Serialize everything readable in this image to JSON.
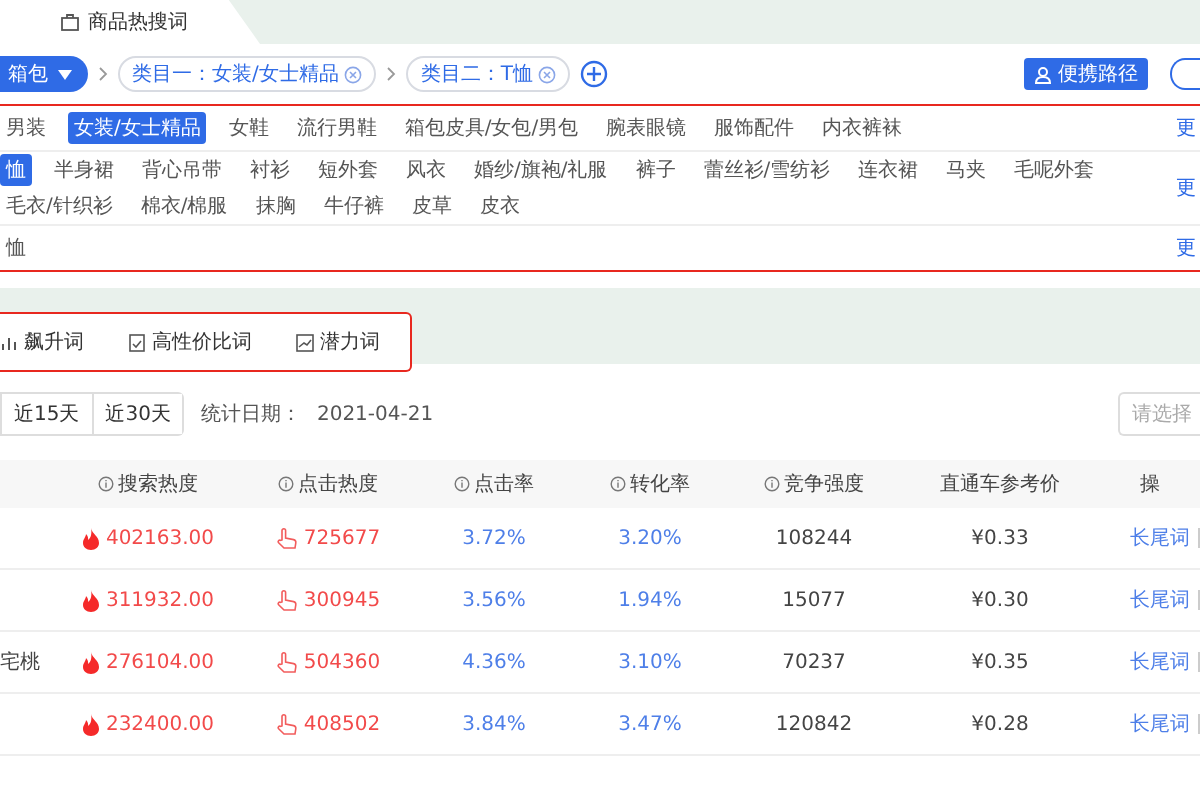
{
  "page_tab": {
    "label": "商品热搜词"
  },
  "filter_bar": {
    "category_button": "箱包",
    "chips": [
      {
        "label": "类目一：女装/女士精品"
      },
      {
        "label": "类目二：T恤"
      }
    ],
    "path_button": "便携路径"
  },
  "category_rows": [
    {
      "items": [
        {
          "label": "男装",
          "selected": false
        },
        {
          "label": "女装/女士精品",
          "selected": true
        },
        {
          "label": "女鞋",
          "selected": false
        },
        {
          "label": "流行男鞋",
          "selected": false
        },
        {
          "label": "箱包皮具/女包/男包",
          "selected": false
        },
        {
          "label": "腕表眼镜",
          "selected": false
        },
        {
          "label": "服饰配件",
          "selected": false
        },
        {
          "label": "内衣裤袜",
          "selected": false
        }
      ],
      "more": "更"
    },
    {
      "items": [
        {
          "label": "恤",
          "selected": true
        },
        {
          "label": "半身裙",
          "selected": false
        },
        {
          "label": "背心吊带",
          "selected": false
        },
        {
          "label": "衬衫",
          "selected": false
        },
        {
          "label": "短外套",
          "selected": false
        },
        {
          "label": "风衣",
          "selected": false
        },
        {
          "label": "婚纱/旗袍/礼服",
          "selected": false
        },
        {
          "label": "裤子",
          "selected": false
        },
        {
          "label": "蕾丝衫/雪纺衫",
          "selected": false
        },
        {
          "label": "连衣裙",
          "selected": false
        },
        {
          "label": "马夹",
          "selected": false
        },
        {
          "label": "毛呢外套",
          "selected": false
        },
        {
          "label": "毛衣/针织衫",
          "selected": false
        },
        {
          "label": "棉衣/棉服",
          "selected": false
        },
        {
          "label": "抹胸",
          "selected": false
        },
        {
          "label": "牛仔裤",
          "selected": false
        },
        {
          "label": "皮草",
          "selected": false
        },
        {
          "label": "皮衣",
          "selected": false
        }
      ],
      "more": "更"
    },
    {
      "items": [
        {
          "label": "恤",
          "selected": false
        }
      ],
      "more": "更"
    }
  ],
  "word_tabs": [
    {
      "label": "飙升词",
      "kind": "rise"
    },
    {
      "label": "高性价比词",
      "kind": "value"
    },
    {
      "label": "潜力词",
      "kind": "potential"
    }
  ],
  "date_range": {
    "buttons": [
      "近15天",
      "近30天"
    ],
    "date_label": "统计日期：",
    "date": "2021-04-21",
    "select_placeholder": "请选择"
  },
  "table": {
    "columns": [
      {
        "label": "搜索热度",
        "info": true
      },
      {
        "label": "点击热度",
        "info": true
      },
      {
        "label": "点击率",
        "info": true
      },
      {
        "label": "转化率",
        "info": true
      },
      {
        "label": "竞争强度",
        "info": true
      },
      {
        "label": "直通车参考价",
        "info": false
      },
      {
        "label": "操",
        "info": false
      }
    ],
    "rows": [
      {
        "keyword": "",
        "search_heat": "402163.00",
        "click_heat": "725677",
        "ctr": "3.72%",
        "cvr": "3.20%",
        "competition": "108244",
        "price": "¥0.33",
        "action": "长尾词"
      },
      {
        "keyword": "",
        "search_heat": "311932.00",
        "click_heat": "300945",
        "ctr": "3.56%",
        "cvr": "1.94%",
        "competition": "15077",
        "price": "¥0.30",
        "action": "长尾词"
      },
      {
        "keyword": "宅桃",
        "search_heat": "276104.00",
        "click_heat": "504360",
        "ctr": "4.36%",
        "cvr": "3.10%",
        "competition": "70237",
        "price": "¥0.35",
        "action": "长尾词"
      },
      {
        "keyword": "",
        "search_heat": "232400.00",
        "click_heat": "408502",
        "ctr": "3.84%",
        "cvr": "3.47%",
        "competition": "120842",
        "price": "¥0.28",
        "action": "长尾词"
      }
    ]
  }
}
